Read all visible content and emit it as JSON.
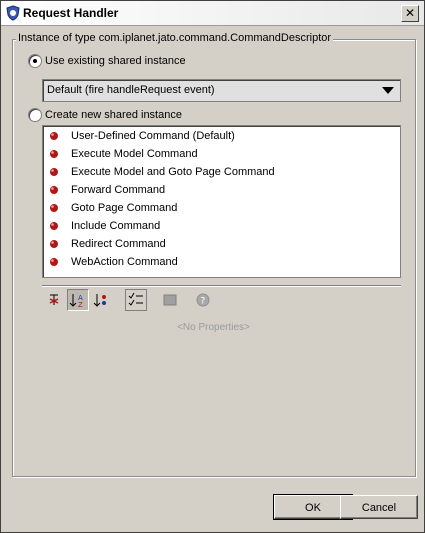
{
  "window": {
    "title": "Request Handler",
    "close_glyph": "✕"
  },
  "group": {
    "legend": "Instance of type com.iplanet.jato.command.CommandDescriptor"
  },
  "option_existing": {
    "label": "Use existing shared instance",
    "selected": true
  },
  "combo": {
    "value": "Default (fire handleRequest event)"
  },
  "option_new": {
    "label": "Create new shared instance",
    "selected": false
  },
  "commands": [
    "User-Defined Command (Default)",
    "Execute Model Command",
    "Execute Model and Goto Page Command",
    "Forward Command",
    "Goto Page Command",
    "Include Command",
    "Redirect Command",
    "WebAction Command"
  ],
  "toolbar": {
    "items": [
      "unsorted-icon",
      "sort-by-name-icon",
      "sort-by-type-icon",
      "property-sheet-icon",
      "customize-icon",
      "help-icon"
    ]
  },
  "properties": {
    "empty_text": "<No Properties>"
  },
  "buttons": {
    "ok": "OK",
    "cancel": "Cancel"
  },
  "colors": {
    "command_icon": "#b01818",
    "title_gradient_start": "#ffffff"
  }
}
